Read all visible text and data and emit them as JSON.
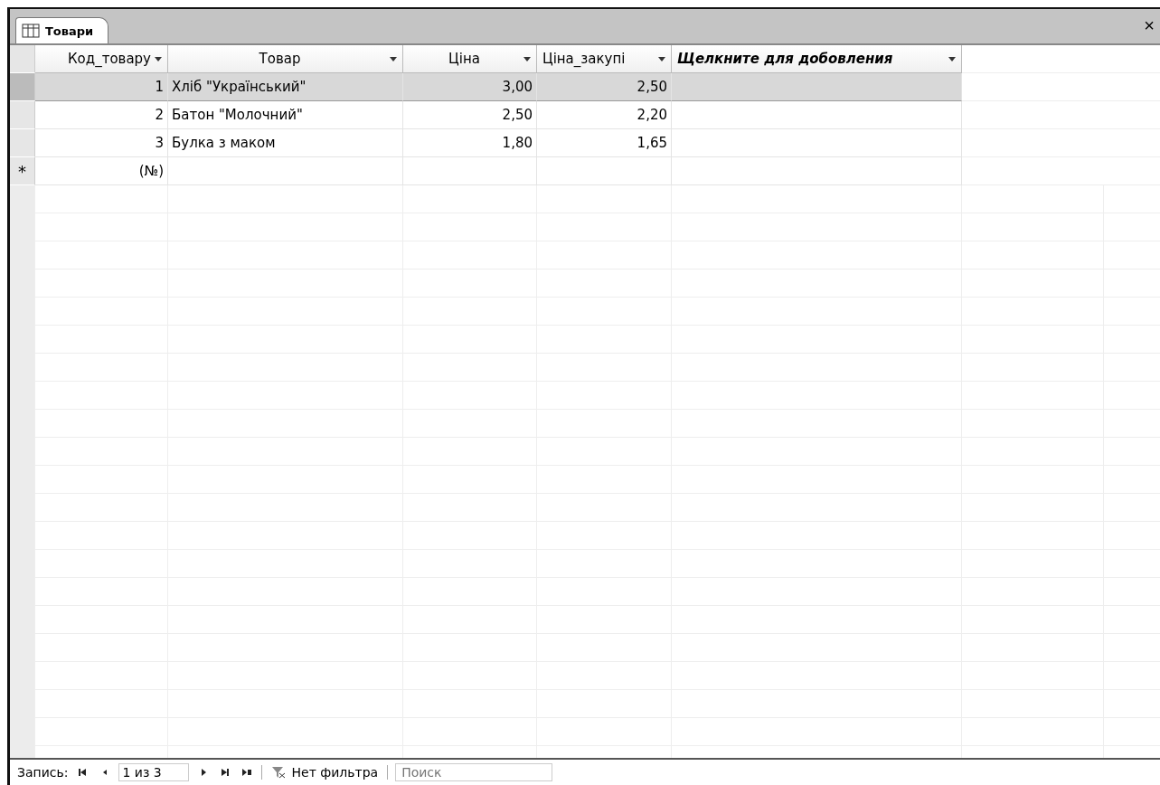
{
  "tab": {
    "label": "Товари",
    "selected": true
  },
  "close": "×",
  "columns": [
    {
      "label": "Код_товару",
      "kind": "field"
    },
    {
      "label": "Товар",
      "kind": "field"
    },
    {
      "label": "Ціна",
      "kind": "field"
    },
    {
      "label": "Ціна_закупі",
      "kind": "field"
    },
    {
      "label": "Щелкните для добовления",
      "kind": "add"
    }
  ],
  "rows": [
    {
      "selected": true,
      "cells": [
        "1",
        "Хліб \"Український\"",
        "3,00",
        "2,50",
        ""
      ]
    },
    {
      "selected": false,
      "cells": [
        "2",
        "Батон \"Молочний\"",
        "2,50",
        "2,20",
        ""
      ]
    },
    {
      "selected": false,
      "cells": [
        "3",
        "Булка з маком",
        "1,80",
        "1,65",
        ""
      ]
    },
    {
      "selected": false,
      "marker": "*",
      "cells": [
        "(№)",
        "",
        "",
        "",
        ""
      ]
    }
  ],
  "navigation": {
    "label": "Запись:",
    "position": "1 из 3",
    "filter": "Нет фильтра",
    "search_placeholder": "Поиск"
  }
}
